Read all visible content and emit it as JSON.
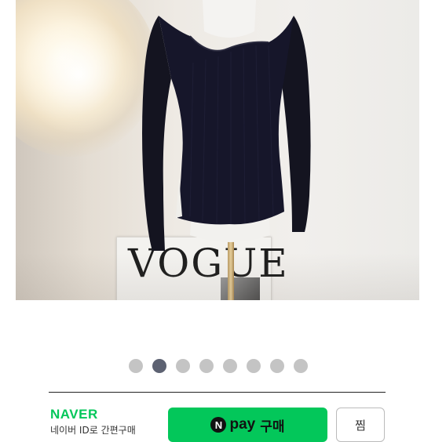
{
  "product_image": {
    "magazine_text": "VOGUE"
  },
  "carousel": {
    "count": 8,
    "active_index": 1
  },
  "purchase_bar": {
    "brand": "NAVER",
    "subtitle": "네이버 ID로 간편구매",
    "pay_icon_letter": "N",
    "pay_label": "pay",
    "pay_action": "구매",
    "wishlist_label": "찜",
    "brand_color": "#03c75a"
  }
}
